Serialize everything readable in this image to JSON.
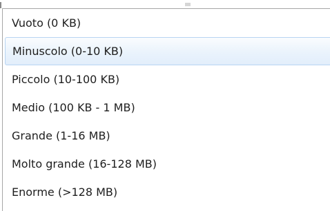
{
  "size_filter_dropdown": {
    "hovered_index": 1,
    "options": [
      {
        "label": "Vuoto (0 KB)"
      },
      {
        "label": "Minuscolo (0-10 KB)"
      },
      {
        "label": "Piccolo (10-100 KB)"
      },
      {
        "label": "Medio (100 KB - 1 MB)"
      },
      {
        "label": "Grande (1-16 MB)"
      },
      {
        "label": "Molto grande (16-128 MB)"
      },
      {
        "label": "Enorme (>128 MB)"
      }
    ]
  },
  "colors": {
    "hover_border": "#b7d4f2",
    "hover_fill": "#e2eefb",
    "text": "#1e1e1e",
    "menu_border": "#a6a6a6"
  }
}
